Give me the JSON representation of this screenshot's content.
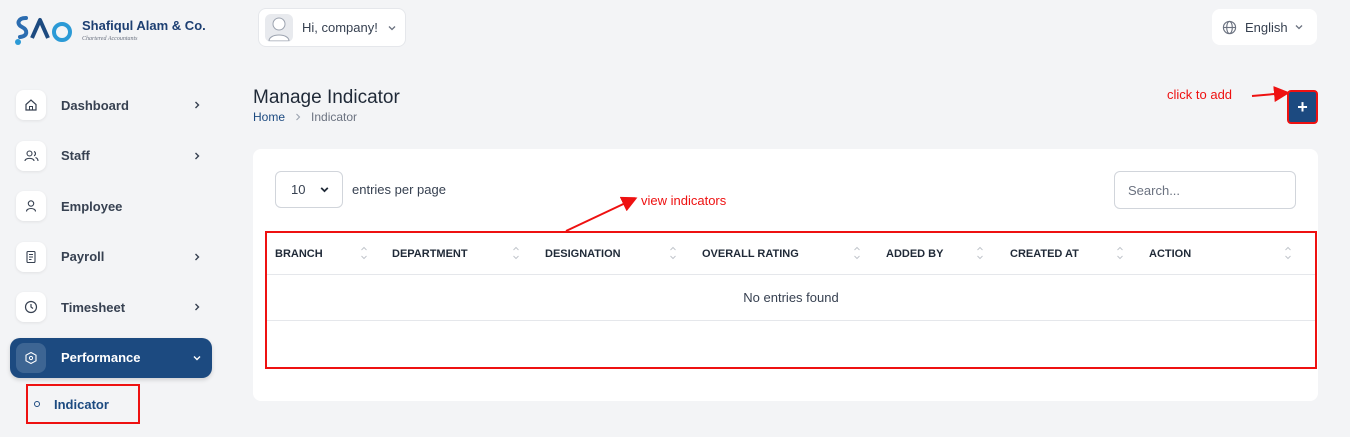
{
  "brand": {
    "name": "Shafiqul Alam & Co.",
    "subtitle": "Chartered Accountants",
    "primary_color": "#1c4a80"
  },
  "header": {
    "greeting": "Hi, company!",
    "language": "English"
  },
  "sidebar": {
    "items": [
      {
        "label": "Dashboard",
        "icon": "home-icon",
        "has_arrow": true
      },
      {
        "label": "Staff",
        "icon": "users-icon",
        "has_arrow": true
      },
      {
        "label": "Employee",
        "icon": "user-icon",
        "has_arrow": false
      },
      {
        "label": "Payroll",
        "icon": "receipt-icon",
        "has_arrow": true
      },
      {
        "label": "Timesheet",
        "icon": "clock-icon",
        "has_arrow": true
      },
      {
        "label": "Performance",
        "icon": "cube-icon",
        "has_arrow": true,
        "active": true,
        "expanded": true
      }
    ],
    "sub_items": [
      {
        "label": "Indicator",
        "active": true
      }
    ]
  },
  "page": {
    "title": "Manage Indicator",
    "breadcrumb": [
      "Home",
      "Indicator"
    ],
    "add_button_label": "+"
  },
  "annotations": {
    "add": "click to add",
    "view": "view indicators",
    "color": "#ee1111"
  },
  "table": {
    "per_page_value": "10",
    "per_page_label": "entries per page",
    "search_placeholder": "Search...",
    "columns": [
      "BRANCH",
      "DEPARTMENT",
      "DESIGNATION",
      "OVERALL RATING",
      "ADDED BY",
      "CREATED AT",
      "ACTION"
    ],
    "empty_message": "No entries found"
  }
}
